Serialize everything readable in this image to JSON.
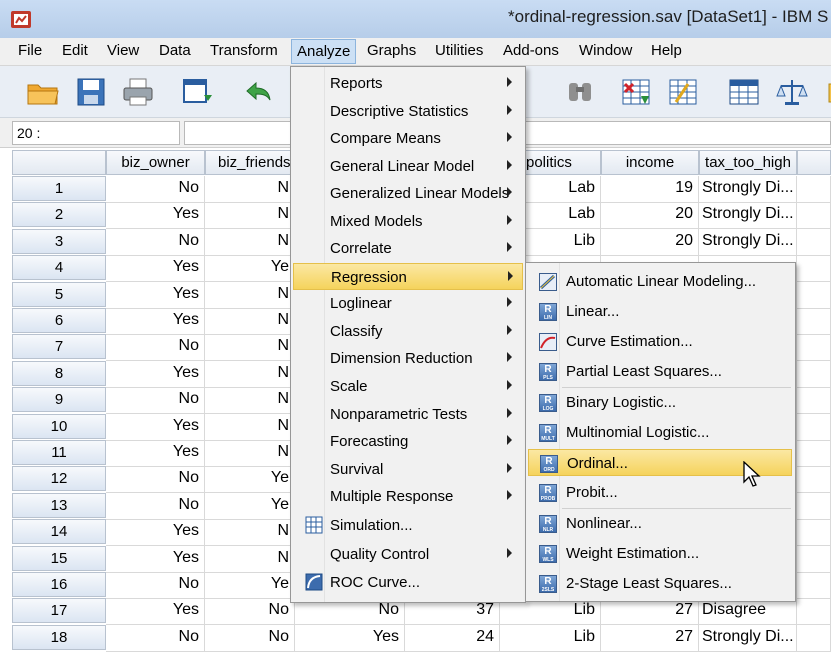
{
  "window": {
    "title": "*ordinal-regression.sav [DataSet1] - IBM S"
  },
  "menubar": [
    "File",
    "Edit",
    "View",
    "Data",
    "Transform",
    "Analyze",
    "Graphs",
    "Utilities",
    "Add-ons",
    "Window",
    "Help"
  ],
  "cell_ref": "20 :",
  "columns": [
    "biz_owner",
    "biz_friends",
    "politics",
    "income",
    "tax_too_high"
  ],
  "rows": [
    {
      "n": "1",
      "biz_owner": "No",
      "biz_friends": "N",
      "politics": "Lab",
      "income": "19",
      "tax_too_high": "Strongly Di..."
    },
    {
      "n": "2",
      "biz_owner": "Yes",
      "biz_friends": "N",
      "politics": "Lab",
      "income": "20",
      "tax_too_high": "Strongly Di..."
    },
    {
      "n": "3",
      "biz_owner": "No",
      "biz_friends": "N",
      "politics": "Lib",
      "income": "20",
      "tax_too_high": "Strongly Di..."
    },
    {
      "n": "4",
      "biz_owner": "Yes",
      "biz_friends": "Ye",
      "politics": "",
      "income": "",
      "tax_too_high": ""
    },
    {
      "n": "5",
      "biz_owner": "Yes",
      "biz_friends": "N",
      "politics": "",
      "income": "",
      "tax_too_high": ""
    },
    {
      "n": "6",
      "biz_owner": "Yes",
      "biz_friends": "N",
      "politics": "",
      "income": "",
      "tax_too_high": ""
    },
    {
      "n": "7",
      "biz_owner": "No",
      "biz_friends": "N",
      "politics": "",
      "income": "",
      "tax_too_high": ""
    },
    {
      "n": "8",
      "biz_owner": "Yes",
      "biz_friends": "N",
      "politics": "",
      "income": "",
      "tax_too_high": ""
    },
    {
      "n": "9",
      "biz_owner": "No",
      "biz_friends": "N",
      "politics": "",
      "income": "",
      "tax_too_high": ""
    },
    {
      "n": "10",
      "biz_owner": "Yes",
      "biz_friends": "N",
      "politics": "",
      "income": "",
      "tax_too_high": ""
    },
    {
      "n": "11",
      "biz_owner": "Yes",
      "biz_friends": "N",
      "politics": "",
      "income": "",
      "tax_too_high": ""
    },
    {
      "n": "12",
      "biz_owner": "No",
      "biz_friends": "Ye",
      "politics": "",
      "income": "",
      "tax_too_high": ""
    },
    {
      "n": "13",
      "biz_owner": "No",
      "biz_friends": "Ye",
      "politics": "",
      "income": "",
      "tax_too_high": ""
    },
    {
      "n": "14",
      "biz_owner": "Yes",
      "biz_friends": "N",
      "politics": "",
      "income": "",
      "tax_too_high": ""
    },
    {
      "n": "15",
      "biz_owner": "Yes",
      "biz_friends": "N",
      "politics": "",
      "income": "",
      "tax_too_high": ""
    },
    {
      "n": "16",
      "biz_owner": "No",
      "biz_friends": "Ye",
      "politics": "",
      "income": "",
      "tax_too_high": ""
    },
    {
      "n": "17",
      "biz_owner": "Yes",
      "biz_friends": "No",
      "extra1": "No",
      "extra2": "37",
      "politics": "Lib",
      "income": "27",
      "tax_too_high": "Disagree"
    },
    {
      "n": "18",
      "biz_owner": "No",
      "biz_friends": "No",
      "extra1": "Yes",
      "extra2": "24",
      "politics": "Lib",
      "income": "27",
      "tax_too_high": "Strongly Di..."
    }
  ],
  "analyze_menu": [
    {
      "label": "Reports",
      "submenu": true
    },
    {
      "label": "Descriptive Statistics",
      "submenu": true
    },
    {
      "label": "Compare Means",
      "submenu": true
    },
    {
      "label": "General Linear Model",
      "submenu": true
    },
    {
      "label": "Generalized Linear Models",
      "submenu": true
    },
    {
      "label": "Mixed Models",
      "submenu": true
    },
    {
      "label": "Correlate",
      "submenu": true
    },
    {
      "label": "Regression",
      "submenu": true,
      "highlighted": true
    },
    {
      "label": "Loglinear",
      "submenu": true
    },
    {
      "label": "Classify",
      "submenu": true
    },
    {
      "label": "Dimension Reduction",
      "submenu": true
    },
    {
      "label": "Scale",
      "submenu": true
    },
    {
      "label": "Nonparametric Tests",
      "submenu": true
    },
    {
      "label": "Forecasting",
      "submenu": true
    },
    {
      "label": "Survival",
      "submenu": true
    },
    {
      "label": "Multiple Response",
      "submenu": true
    },
    {
      "label": "Simulation...",
      "submenu": false,
      "icon": "simulation-icon"
    },
    {
      "label": "Quality Control",
      "submenu": true
    },
    {
      "label": "ROC Curve...",
      "submenu": false,
      "icon": "roc-curve-icon"
    }
  ],
  "regression_menu": [
    {
      "label": "Automatic Linear Modeling...",
      "icon_text": ""
    },
    {
      "label": "Linear...",
      "icon_text": "LIN"
    },
    {
      "label": "Curve Estimation...",
      "icon_text": ""
    },
    {
      "label": "Partial Least Squares...",
      "icon_text": "PLS"
    },
    {
      "label": "Binary Logistic...",
      "icon_text": "LOG"
    },
    {
      "label": "Multinomial Logistic...",
      "icon_text": "MULT"
    },
    {
      "label": "Ordinal...",
      "icon_text": "ORD",
      "highlighted": true
    },
    {
      "label": "Probit...",
      "icon_text": "PROB"
    },
    {
      "label": "Nonlinear...",
      "icon_text": "NLR"
    },
    {
      "label": "Weight Estimation...",
      "icon_text": "WLS"
    },
    {
      "label": "2-Stage Least Squares...",
      "icon_text": "2SLS"
    }
  ]
}
